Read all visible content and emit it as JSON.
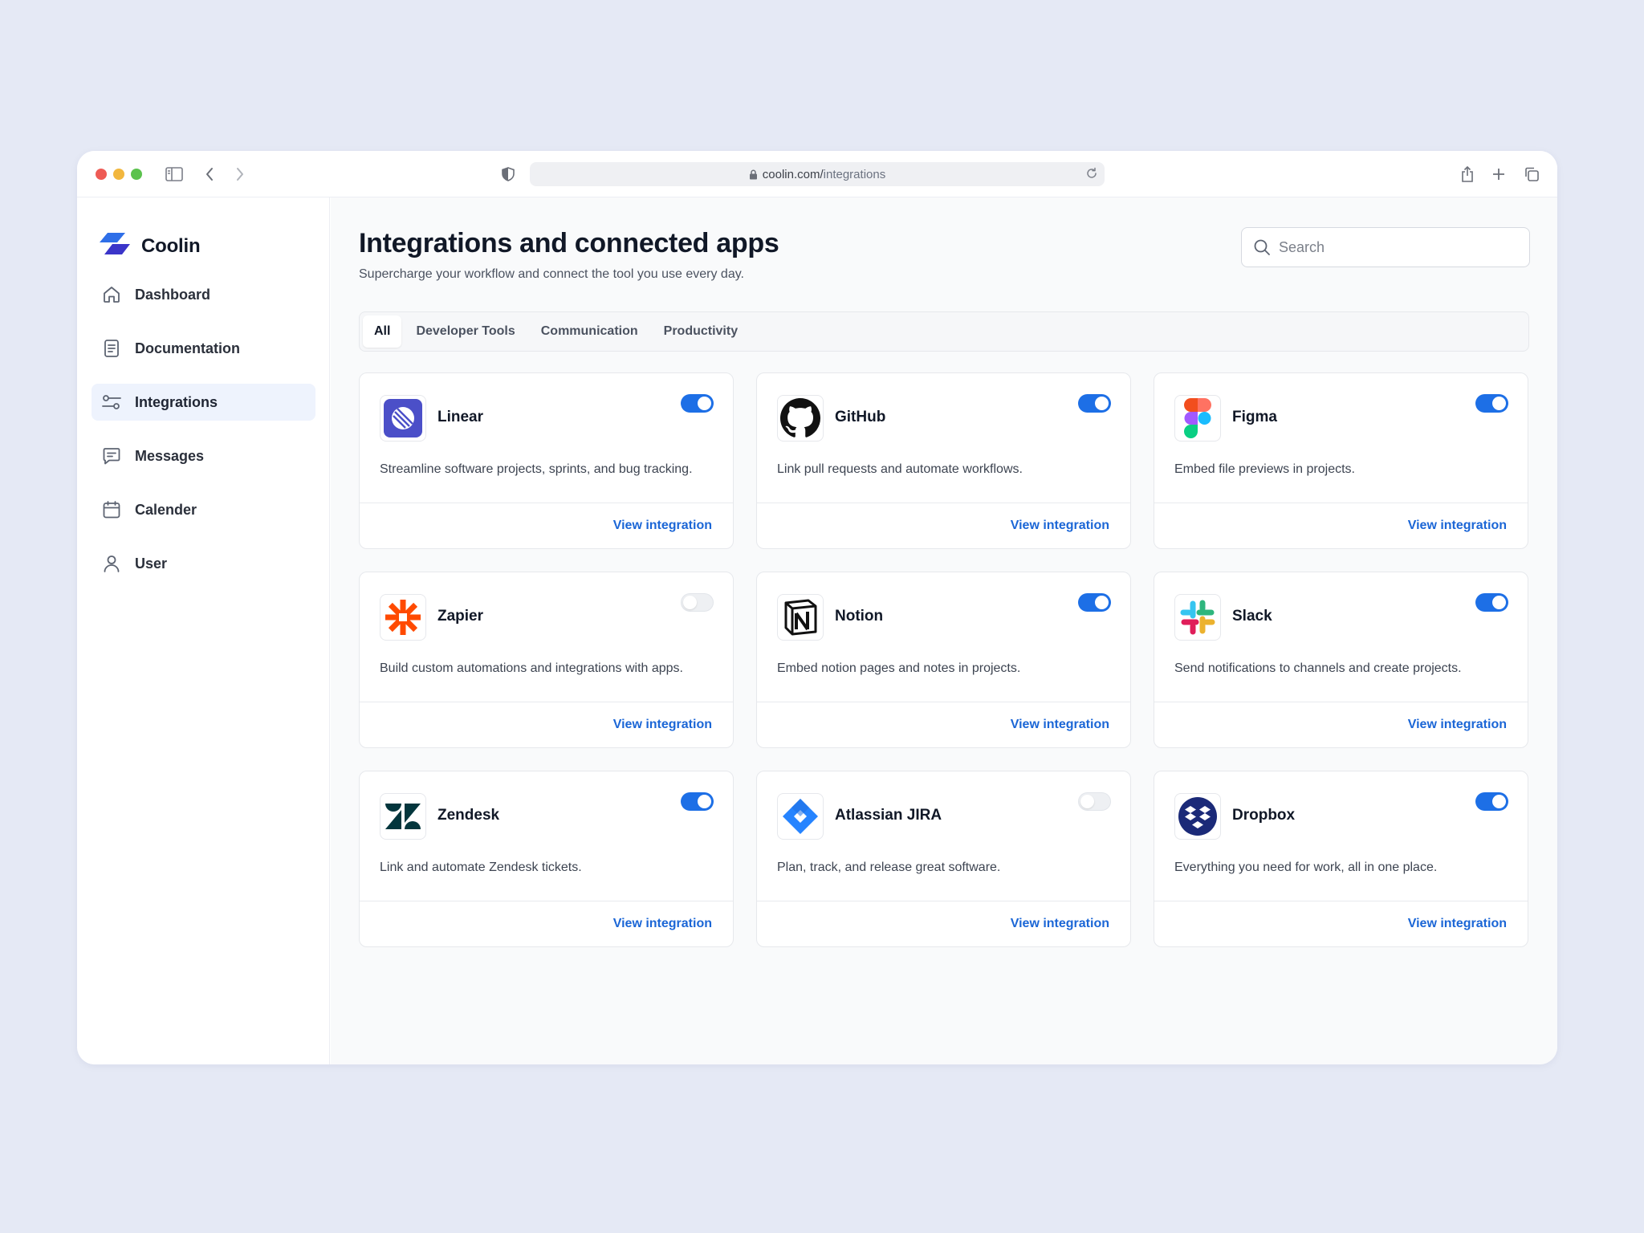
{
  "browser": {
    "url_host": "coolin.com/",
    "url_path": "integrations"
  },
  "brand": {
    "name": "Coolin"
  },
  "sidebar": {
    "items": [
      {
        "label": "Dashboard",
        "icon": "home-icon",
        "active": false
      },
      {
        "label": "Documentation",
        "icon": "document-icon",
        "active": false
      },
      {
        "label": "Integrations",
        "icon": "integrations-icon",
        "active": true
      },
      {
        "label": "Messages",
        "icon": "message-icon",
        "active": false
      },
      {
        "label": "Calender",
        "icon": "calendar-icon",
        "active": false
      },
      {
        "label": "User",
        "icon": "user-icon",
        "active": false
      }
    ]
  },
  "header": {
    "title": "Integrations and connected apps",
    "subtitle": "Supercharge your workflow and connect the tool you use every day."
  },
  "search": {
    "placeholder": "Search",
    "value": ""
  },
  "tabs": [
    {
      "label": "All",
      "active": true
    },
    {
      "label": "Developer Tools",
      "active": false
    },
    {
      "label": "Communication",
      "active": false
    },
    {
      "label": "Productivity",
      "active": false
    }
  ],
  "cards": [
    {
      "name": "Linear",
      "logo": "linear-icon",
      "enabled": true,
      "description": "Streamline software projects, sprints, and bug tracking.",
      "link": "View integration"
    },
    {
      "name": "GitHub",
      "logo": "github-icon",
      "enabled": true,
      "description": "Link pull requests and automate workflows.",
      "link": "View integration"
    },
    {
      "name": "Figma",
      "logo": "figma-icon",
      "enabled": true,
      "description": "Embed file previews in projects.",
      "link": "View integration"
    },
    {
      "name": "Zapier",
      "logo": "zapier-icon",
      "enabled": false,
      "description": "Build custom automations and integrations with apps.",
      "link": "View integration"
    },
    {
      "name": "Notion",
      "logo": "notion-icon",
      "enabled": true,
      "description": "Embed notion pages and notes in projects.",
      "link": "View integration"
    },
    {
      "name": "Slack",
      "logo": "slack-icon",
      "enabled": true,
      "description": "Send notifications to channels and create projects.",
      "link": "View integration"
    },
    {
      "name": "Zendesk",
      "logo": "zendesk-icon",
      "enabled": true,
      "description": "Link and automate Zendesk tickets.",
      "link": "View integration"
    },
    {
      "name": "Atlassian JIRA",
      "logo": "jira-icon",
      "enabled": false,
      "description": "Plan, track, and release great software.",
      "link": "View integration"
    },
    {
      "name": "Dropbox",
      "logo": "dropbox-icon",
      "enabled": true,
      "description": "Everything you need for work, all in one place.",
      "link": "View integration"
    }
  ],
  "colors": {
    "accent": "#1d6fe6",
    "link": "#1b66d6",
    "active_nav_bg": "#eef3fd",
    "background": "#e5e9f5"
  }
}
